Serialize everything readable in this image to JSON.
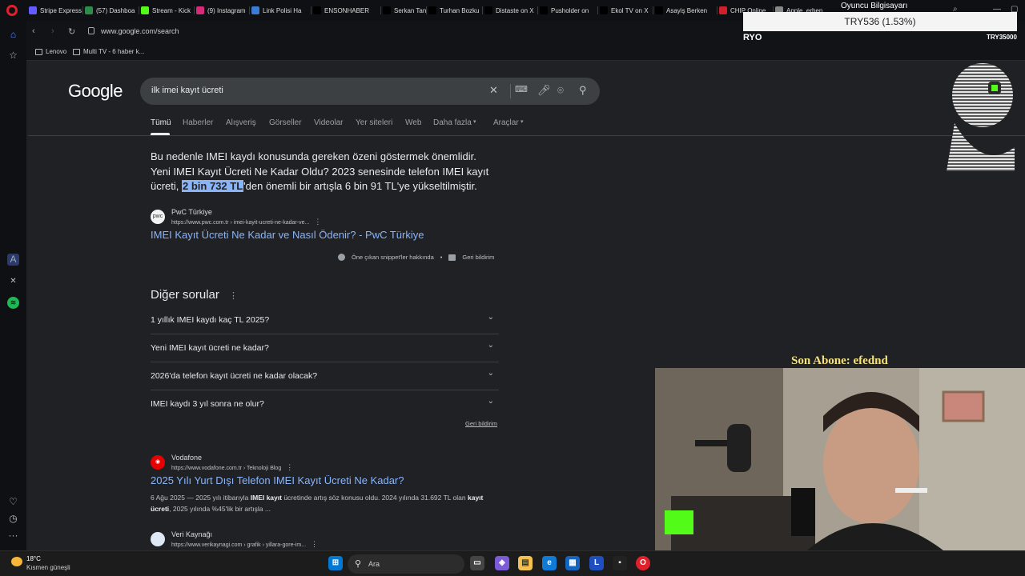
{
  "browser": {
    "tabs": [
      {
        "label": "Stripe Express",
        "color": "#635bff"
      },
      {
        "label": "(57) Dashboa",
        "color": "#2d8c4a"
      },
      {
        "label": "Stream - Kick",
        "color": "#53fc18"
      },
      {
        "label": "(9) Instagram",
        "color": "#d62976"
      },
      {
        "label": "Link Polisi Ha",
        "color": "#3a7bd5"
      },
      {
        "label": "ENSONHABER",
        "color": "#000000"
      },
      {
        "label": "Serkan Tanyıl",
        "color": "#000000"
      },
      {
        "label": "Turhan Bozku",
        "color": "#000000"
      },
      {
        "label": "Distaste on X",
        "color": "#000000"
      },
      {
        "label": "Pusholder on",
        "color": "#000000"
      },
      {
        "label": "Ekol TV on X",
        "color": "#000000"
      },
      {
        "label": "Asayiş Berken",
        "color": "#000000"
      },
      {
        "label": "CHIP Online",
        "color": "#d0202a"
      },
      {
        "label": "Apple, erben",
        "color": "#888888"
      }
    ],
    "address": {
      "url": "www.google.com/search"
    },
    "bookmarks": [
      "Lenovo",
      "Multi TV - 6 haber k..."
    ]
  },
  "search": {
    "logo": "Google",
    "query": "ilk imei kayıt ücreti",
    "tabs": [
      "Tümü",
      "Haberler",
      "Alışveriş",
      "Görseller",
      "Videolar",
      "Yer siteleri",
      "Web",
      "Daha fazla",
      "Araçlar"
    ]
  },
  "featured": {
    "line1": "Bu nedenle IMEI kaydı konusunda gereken özeni göstermek önemlidir.",
    "line2": "Yeni IMEI Kayıt Ücreti Ne Kadar Oldu? 2023 senesinde telefon IMEI kayıt",
    "line3_pre": "ücreti, ",
    "line3_highlight": "2 bin 732 TL",
    "line3_post": "'den önemli bir artışla 6 bin 91 TL'ye yükseltilmiştir.",
    "source_name": "PwC Türkiye",
    "source_url": "https://www.pwc.com.tr › imei-kayit-ucreti-ne-kadar-ve...",
    "title": "IMEI Kayıt Ücreti Ne Kadar ve Nasıl Ödenir? - PwC Türkiye",
    "about_snippets": "Öne çıkan snippet'ler hakkında",
    "feedback": "Geri bildirim"
  },
  "paa": {
    "title": "Diğer sorular",
    "questions": [
      "1 yıllık IMEI kaydı kaç TL 2025?",
      "Yeni IMEI kayıt ücreti ne kadar?",
      "2026'da telefon kayıt ücreti ne kadar olacak?",
      "IMEI kaydı 3 yıl sonra ne olur?"
    ],
    "feedback": "Geri bildirim"
  },
  "result2": {
    "source_name": "Vodafone",
    "source_url": "https://www.vodafone.com.tr › Teknoloji Blog",
    "title": "2025 Yılı Yurt Dışı Telefon IMEI Kayıt Ücreti Ne Kadar?",
    "date": "6 Ağu 2025",
    "snippet_a": " — 2025 yılı itibarıyla ",
    "snippet_b": "IMEI kayıt",
    "snippet_c": " ücretinde artış söz konusu oldu. 2024 yılında 31.692 TL olan ",
    "snippet_d": "kayıt ücreti",
    "snippet_e": ", 2025 yılında %45'lik bir artışla ..."
  },
  "result3": {
    "source_name": "Veri Kaynağı",
    "source_url": "https://www.verikaynagi.com › grafik › yillara-gore-im..."
  },
  "overlay": {
    "ticker": "TRY536 (1.53%)",
    "ticker_top": "Oyuncu Bilgisayarı",
    "ryo": "RYO",
    "try35000": "TRY35000",
    "last_sub": "Son Abone: efednd"
  },
  "taskbar": {
    "temp": "18°C",
    "weather": "Kısmen güneşli",
    "search_label": "Ara"
  }
}
